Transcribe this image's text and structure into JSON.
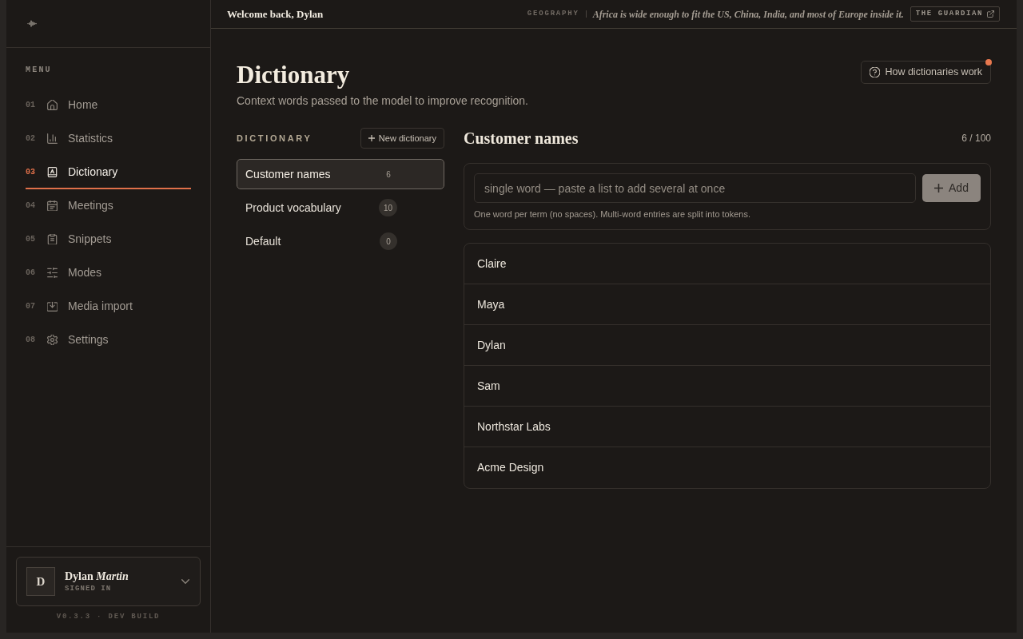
{
  "sidebar": {
    "section_label": "MENU",
    "items": [
      {
        "number": "01",
        "label": "Home",
        "selected": false
      },
      {
        "number": "02",
        "label": "Statistics",
        "selected": false
      },
      {
        "number": "03",
        "label": "Dictionary",
        "selected": true
      },
      {
        "number": "04",
        "label": "Meetings",
        "selected": false
      },
      {
        "number": "05",
        "label": "Snippets",
        "selected": false
      },
      {
        "number": "06",
        "label": "Modes",
        "selected": false
      },
      {
        "number": "07",
        "label": "Media import",
        "selected": false
      },
      {
        "number": "08",
        "label": "Settings",
        "selected": false
      }
    ],
    "user": {
      "initial": "D",
      "name": "Dylan *Martin*",
      "status": "SIGNED IN"
    },
    "version": "V0.3.3 · DEV BUILD"
  },
  "top_bar": {
    "greeting": "Welcome back, Dylan",
    "fact": {
      "category": "GEOGRAPHY",
      "text": "Africa is wide enough to fit the US, China, India, and most of Europe inside it.",
      "source": "THE GUARDIAN"
    }
  },
  "header": {
    "title": "Dictionary",
    "subtitle": "Context words passed to the model to improve recognition.",
    "help_button": {
      "label": "How dictionaries work",
      "notification": true
    }
  },
  "dictionaries": {
    "label": "DICTIONARY",
    "new_button": "New dictionary",
    "items": [
      {
        "name": "Customer names",
        "count": "6",
        "selected": true
      },
      {
        "name": "Product vocabulary",
        "count": "10",
        "selected": false
      },
      {
        "name": "Default",
        "count": "0",
        "selected": false
      }
    ]
  },
  "editor": {
    "title": "Customer names",
    "usage": "6 / 100",
    "input": {
      "placeholder": "single word — paste a list to add several at once"
    },
    "add_button": "Add",
    "hint": "One word per term (no spaces). Multi-word entries are split into tokens.",
    "terms": [
      "Claire",
      "Maya",
      "Dylan",
      "Sam",
      "Northstar Labs",
      "Acme Design"
    ]
  }
}
